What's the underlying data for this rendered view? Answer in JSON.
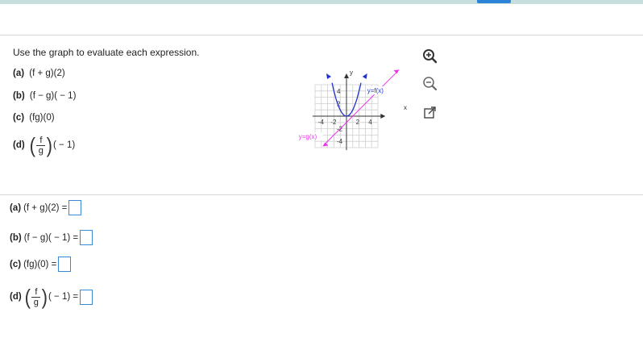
{
  "prompt": "Use the graph to evaluate each expression.",
  "questions": [
    {
      "part": "(a)",
      "expr": "(f + g)(2)"
    },
    {
      "part": "(b)",
      "expr": "(f − g)( − 1)"
    },
    {
      "part": "(c)",
      "expr": "(fg)(0)"
    }
  ],
  "question_d": {
    "part": "(d)",
    "numerator": "f",
    "denominator": "g",
    "arg": "( − 1)"
  },
  "answers": [
    {
      "part": "(a)",
      "expr": "(f + g)(2) ="
    },
    {
      "part": "(b)",
      "expr": "(f − g)( − 1) ="
    },
    {
      "part": "(c)",
      "expr": "(fg)(0) ="
    }
  ],
  "answer_d": {
    "part": "(d)",
    "numerator": "f",
    "denominator": "g",
    "arg": "( − 1) ="
  },
  "graph": {
    "x_axis_label": "x",
    "y_axis_label": "y",
    "f_label": "y=f(x)",
    "g_label": "y=g(x)",
    "x_ticks": [
      "-4",
      "-2",
      "2",
      "4"
    ],
    "y_ticks": [
      "4",
      "2",
      "-2",
      "-4"
    ],
    "f_color": "#2233cc",
    "g_color": "#ee33ee"
  },
  "tools": {
    "zoom_in": "zoom-in-icon",
    "zoom_out": "zoom-out-icon",
    "popout": "popout-icon"
  }
}
